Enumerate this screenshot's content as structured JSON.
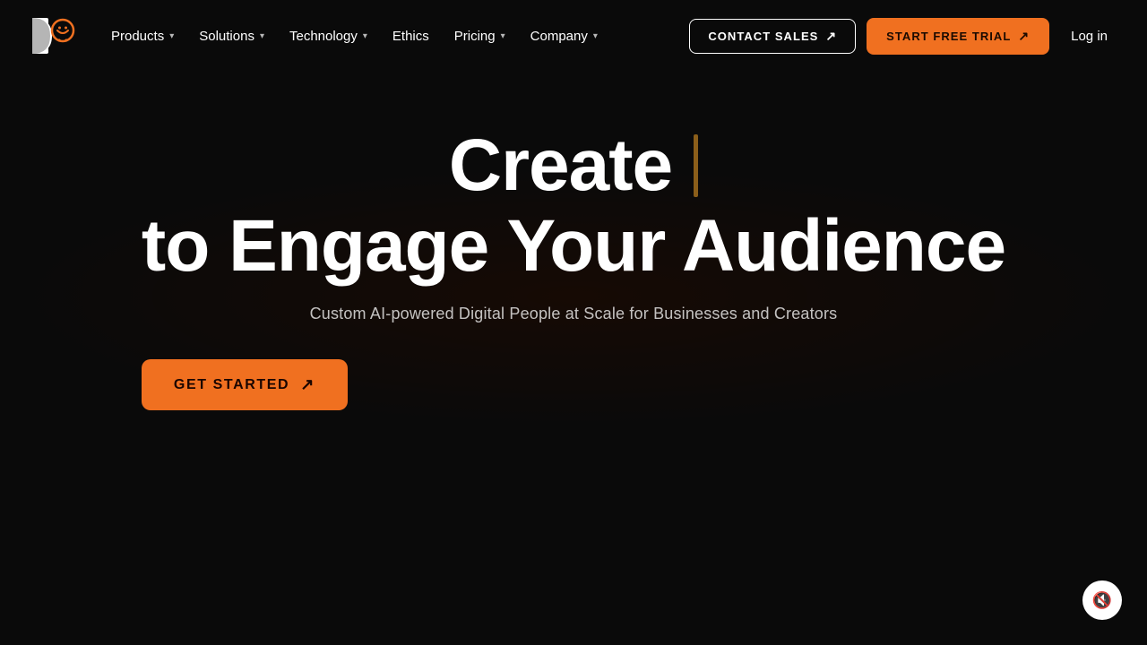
{
  "logo": {
    "alt": "D-ID logo"
  },
  "nav": {
    "items": [
      {
        "label": "Products",
        "hasDropdown": true
      },
      {
        "label": "Solutions",
        "hasDropdown": true
      },
      {
        "label": "Technology",
        "hasDropdown": true
      },
      {
        "label": "Ethics",
        "hasDropdown": false
      },
      {
        "label": "Pricing",
        "hasDropdown": true
      },
      {
        "label": "Company",
        "hasDropdown": true
      }
    ],
    "contact_sales_label": "CONTACT SALES",
    "start_trial_label": "START FREE TRIAL",
    "login_label": "Log in"
  },
  "hero": {
    "heading_line1": "Create",
    "heading_line2": "to Engage Your Audience",
    "subtext": "Custom AI-powered Digital People at Scale for Businesses and Creators",
    "cta_label": "GET STARTED"
  },
  "mute": {
    "label": "mute"
  }
}
